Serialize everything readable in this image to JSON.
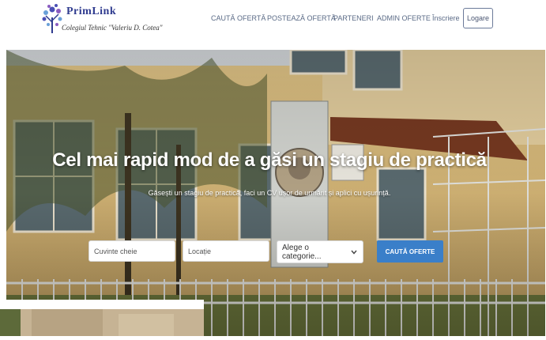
{
  "brand": {
    "name": "PrimLink",
    "subtitle": "Colegiul Tehnic \"Valeriu D. Cotea\""
  },
  "nav": {
    "items": [
      "CAUTĂ OFERTĂ",
      "POSTEAZĂ OFERTĂ",
      "PARTENERI",
      "ADMIN OFERTE",
      "Înscriere"
    ],
    "login_label": "Logare"
  },
  "hero": {
    "title": "Cel mai rapid mod de a găsi un stagiu de practică",
    "subtitle": "Găsești un stagiu de practică, faci un CV ușor de urmărit și aplici cu ușurință."
  },
  "search": {
    "keywords_placeholder": "Cuvinte cheie",
    "location_placeholder": "Locație",
    "category_value": "Alege o categorie...",
    "button_label": "CAUTĂ OFERTE"
  },
  "colors": {
    "accent": "#3a7fc9",
    "brand": "#2f3b8f",
    "nav_text": "#5a6a86"
  }
}
